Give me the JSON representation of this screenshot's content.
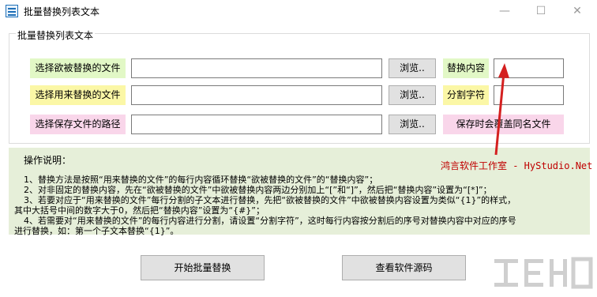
{
  "window": {
    "title": "批量替换列表文本",
    "minimize": "—",
    "maximize": "☐",
    "close": "✕"
  },
  "group": {
    "title": "批量替换列表文本"
  },
  "rows": [
    {
      "label": "选择欲被替换的文件",
      "browse": "浏览.."
    },
    {
      "label": "选择用来替换的文件",
      "browse": "浏览.."
    },
    {
      "label": "选择保存文件的路径",
      "browse": "浏览.."
    }
  ],
  "options": {
    "replace_content_label": "替换内容",
    "split_char_label": "分割字符",
    "save_note": "保存时会覆盖同名文件"
  },
  "instructions": {
    "title": "操作说明：",
    "author": "鸿言软件工作室 - HyStudio.Net",
    "lines": [
      "1、替换方法是按照“用来替换的文件”的每行内容循环替换“欲被替换的文件”的“替换内容”；",
      "2、对非固定的替换内容，先在“欲被替换的文件”中欲被替换内容两边分别加上“[”和“]”，然后把“替换内容”设置为“[*]”；",
      "3、若要对应于“用来替换的文件”每行分割的子文本进行替换，先把“欲被替换的文件”中欲被替换内容设置为类似“{1}”的样式，",
      "其中大括号中间的数字大于0，然后把“替换内容”设置为“{#}”；",
      "4、若需要对“用来替换的文件”的每行内容进行分割，请设置“分割字符”，这时每行内容按分割后的序号对替换内容中对应的序号",
      "进行替换，如：第一个子文本替换“{1}”。"
    ]
  },
  "buttons": {
    "start": "开始批量替换",
    "source": "查看软件源码"
  },
  "colors": {
    "green_label": "#e2f8c6",
    "yellow_label": "#fbf7a6",
    "pink_label": "#f9d6ea",
    "instructions_bg": "#e6efd9",
    "author_red": "#c00000"
  }
}
